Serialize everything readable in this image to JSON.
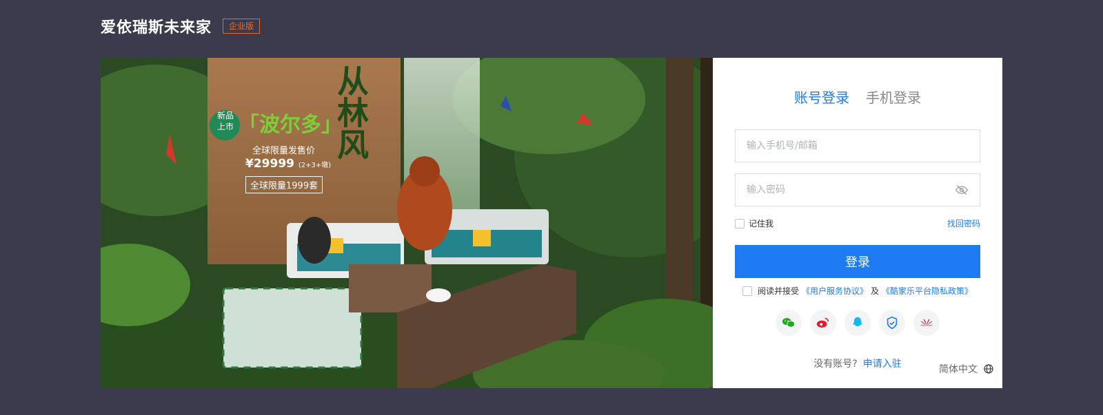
{
  "header": {
    "brand": "爱依瑞斯未来家",
    "edition_badge": "企业版"
  },
  "banner": {
    "new_badge_line1": "新品",
    "new_badge_line2": "上市",
    "product_name": "「波尔多」",
    "slogan": "全球限量发售价",
    "price": "¥29999",
    "price_note": "(2+3+墩)",
    "limited": "全球限量1999套",
    "title_vertical": "从林风"
  },
  "login": {
    "tabs": [
      {
        "label": "账号登录",
        "active": true
      },
      {
        "label": "手机登录",
        "active": false
      }
    ],
    "account_placeholder": "输入手机号/邮箱",
    "password_placeholder": "输入密码",
    "remember_label": "记住我",
    "forgot_label": "找回密码",
    "submit_label": "登录",
    "agree_prefix": "阅读并接受",
    "agree_link1": "《用户服务协议》",
    "agree_and": "及",
    "agree_link2": "《酷家乐平台隐私政策》",
    "socials": [
      "wechat-icon",
      "weibo-icon",
      "qq-icon",
      "shield-icon",
      "huawei-icon"
    ],
    "no_account": "没有账号?",
    "signup_link": "申请入驻",
    "language": "简体中文"
  },
  "colors": {
    "background": "#3c3b4e",
    "accent": "#1e7bf4",
    "badge": "#f26b1d"
  }
}
